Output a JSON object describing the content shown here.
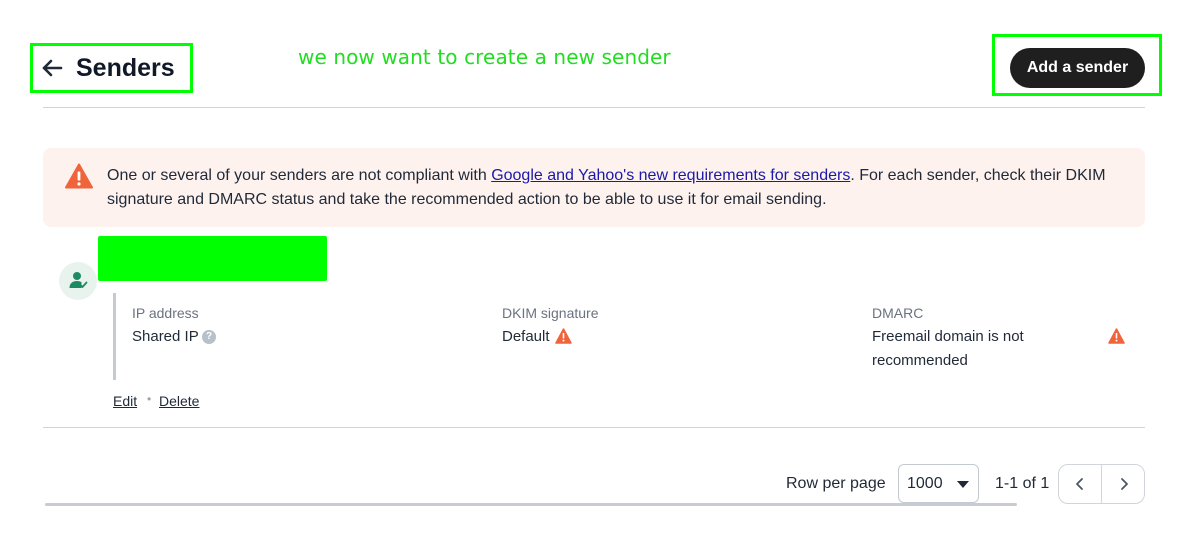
{
  "header": {
    "title": "Senders",
    "add_button_label": "Add a sender"
  },
  "annotation": {
    "text": "we now want to create a new sender",
    "color": "#22dd22"
  },
  "alert": {
    "text_before": "One or several of your senders are not compliant with ",
    "link_text": "Google and Yahoo's new requirements for senders",
    "text_after": ". For each sender, check their DKIM signature and DMARC status and take the recommended action to be able to use it for email sending.",
    "icon": "warning-icon",
    "icon_color": "#f0643c"
  },
  "sender": {
    "ip_label": "IP address",
    "ip_value": "Shared IP",
    "dkim_label": "DKIM signature",
    "dkim_value": "Default",
    "dmarc_label": "DMARC",
    "dmarc_value": "Freemail domain is not recommended",
    "edit_label": "Edit",
    "delete_label": "Delete",
    "separator": "•"
  },
  "pagination": {
    "rows_label": "Row per page",
    "rows_value": "1000",
    "range_text": "1-1 of 1"
  },
  "colors": {
    "accent_dark": "#1f1f1f",
    "warning": "#f0643c",
    "highlight": "#00ff00"
  }
}
